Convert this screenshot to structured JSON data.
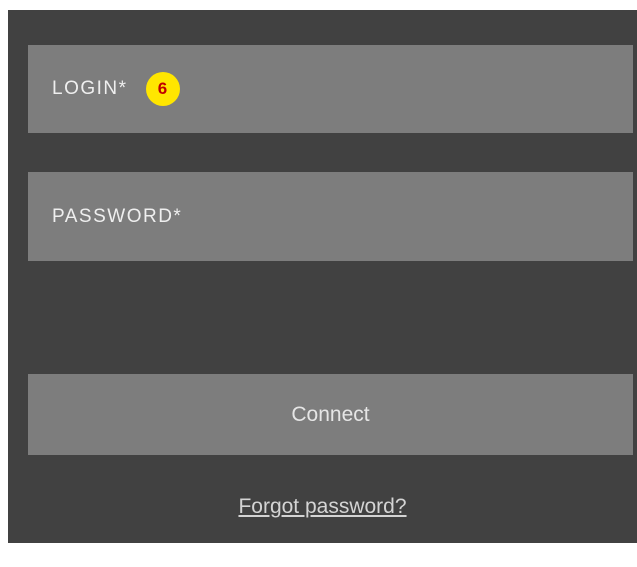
{
  "login_field": {
    "label": "LOGIN*",
    "badge": "6"
  },
  "password_field": {
    "label": "PASSWORD*"
  },
  "connect_button": {
    "label": "Connect"
  },
  "forgot_link": {
    "label": "Forgot password?"
  },
  "colors": {
    "panel_background": "#414141",
    "field_background": "#7d7d7d",
    "badge_background": "#ffe600",
    "badge_text": "#c00000"
  }
}
